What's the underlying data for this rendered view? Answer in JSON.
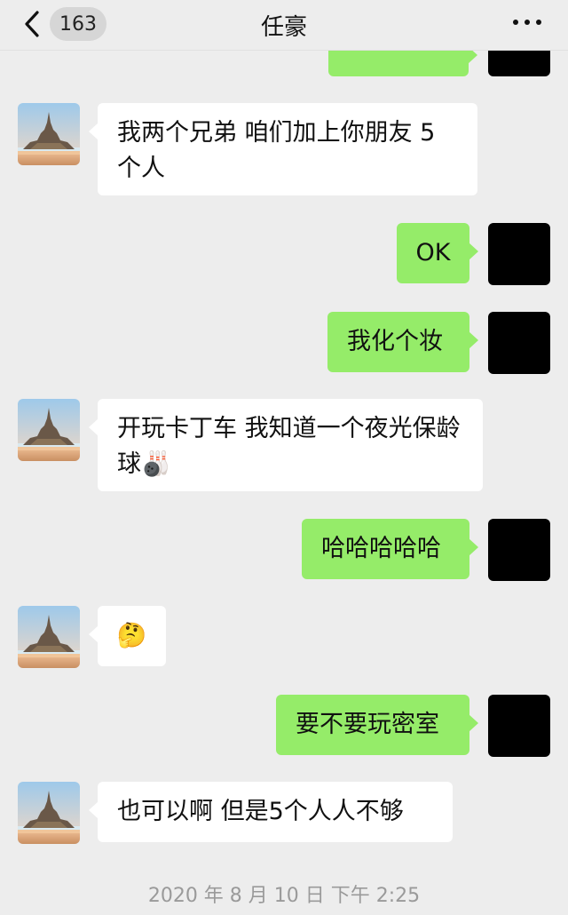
{
  "header": {
    "unread_count": "163",
    "title": "任豪"
  },
  "messages": [
    {
      "side": "left",
      "text": "我两个兄弟 咱们加上你朋友 5个人"
    },
    {
      "side": "right",
      "text": "OK"
    },
    {
      "side": "right",
      "text": "我化个妆"
    },
    {
      "side": "left",
      "text": "开玩卡丁车 我知道一个夜光保龄球🎳"
    },
    {
      "side": "right",
      "text": "哈哈哈哈哈"
    },
    {
      "side": "left",
      "text": "🤔"
    },
    {
      "side": "right",
      "text": "要不要玩密室"
    },
    {
      "side": "left",
      "text": "也可以啊 但是5个人人不够"
    }
  ],
  "timestamp": "2020 年 8 月 10 日 下午 2:25"
}
